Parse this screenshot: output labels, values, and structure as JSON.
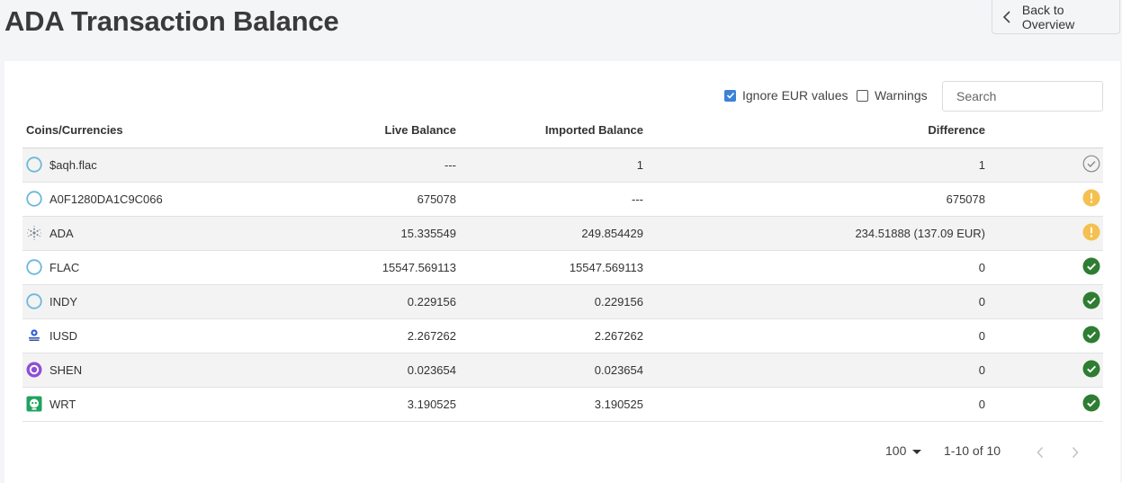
{
  "header": {
    "title": "ADA Transaction Balance",
    "back_label": "Back to Overview"
  },
  "toolbar": {
    "ignore_eur_label": "Ignore EUR values",
    "ignore_eur_checked": true,
    "warnings_label": "Warnings",
    "warnings_checked": false,
    "search_placeholder": "Search"
  },
  "table": {
    "columns": [
      "Coins/Currencies",
      "Live Balance",
      "Imported Balance",
      "Difference"
    ],
    "rows": [
      {
        "coin": "$aqh.flac",
        "icon": "ring-icon",
        "live": "---",
        "imported": "1",
        "difference": "1",
        "status": "check-outline-icon"
      },
      {
        "coin": "A0F1280DA1C9C066",
        "icon": "ring-icon",
        "live": "675078",
        "imported": "---",
        "difference": "675078",
        "status": "warning-icon"
      },
      {
        "coin": "ADA",
        "icon": "cardano-logo-icon",
        "live": "15.335549",
        "imported": "249.854429",
        "difference": "234.51888 (137.09 EUR)",
        "status": "warning-icon"
      },
      {
        "coin": "FLAC",
        "icon": "ring-icon",
        "live": "15547.569113",
        "imported": "15547.569113",
        "difference": "0",
        "status": "check-filled-icon"
      },
      {
        "coin": "INDY",
        "icon": "ring-icon",
        "live": "0.229156",
        "imported": "0.229156",
        "difference": "0",
        "status": "check-filled-icon"
      },
      {
        "coin": "IUSD",
        "icon": "iusd-logo-icon",
        "live": "2.267262",
        "imported": "2.267262",
        "difference": "0",
        "status": "check-filled-icon"
      },
      {
        "coin": "SHEN",
        "icon": "shen-logo-icon",
        "live": "0.023654",
        "imported": "0.023654",
        "difference": "0",
        "status": "check-filled-icon"
      },
      {
        "coin": "WRT",
        "icon": "wrt-logo-icon",
        "live": "3.190525",
        "imported": "3.190525",
        "difference": "0",
        "status": "check-filled-icon"
      }
    ]
  },
  "pagination": {
    "per_page": "100",
    "range": "1-10 of 10"
  },
  "colors": {
    "accent": "#3b82d6",
    "success": "#2e7d32",
    "warning": "#f4c04f",
    "ring": "#6cb8d8"
  }
}
